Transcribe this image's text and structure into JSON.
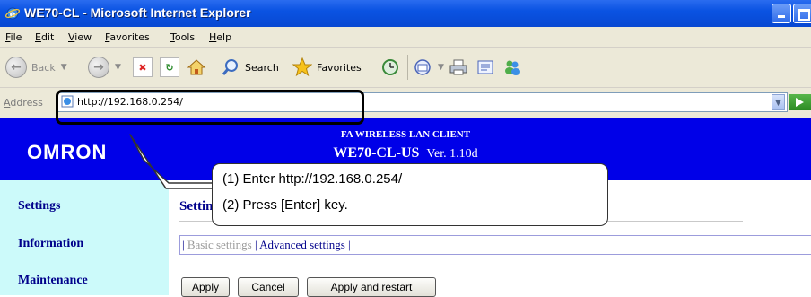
{
  "window": {
    "title": "WE70-CL - Microsoft Internet Explorer"
  },
  "menu": [
    "File",
    "Edit",
    "View",
    "Favorites",
    "Tools",
    "Help"
  ],
  "toolbar": {
    "back_label": "Back",
    "search_label": "Search",
    "favorites_label": "Favorites"
  },
  "address": {
    "label": "Address",
    "url": "http://192.168.0.254/"
  },
  "banner": {
    "logo": "OMRON",
    "product_name": "FA WIRELESS LAN CLIENT",
    "model": "WE70-CL-US",
    "version": "Ver. 1.10d",
    "bg_color": "#0000e8"
  },
  "sidebar": {
    "bg_color": "#ccfafa",
    "items": [
      "Settings",
      "Information",
      "Maintenance"
    ]
  },
  "content": {
    "heading": "Settings",
    "subnav": {
      "sep": "|",
      "current": "Basic settings",
      "link": "Advanced settings"
    },
    "buttons": [
      "Apply",
      "Cancel",
      "Apply and restart"
    ]
  },
  "callout": {
    "step1": "(1) Enter http://192.168.0.254/",
    "step2": "(2) Press [Enter] key."
  }
}
